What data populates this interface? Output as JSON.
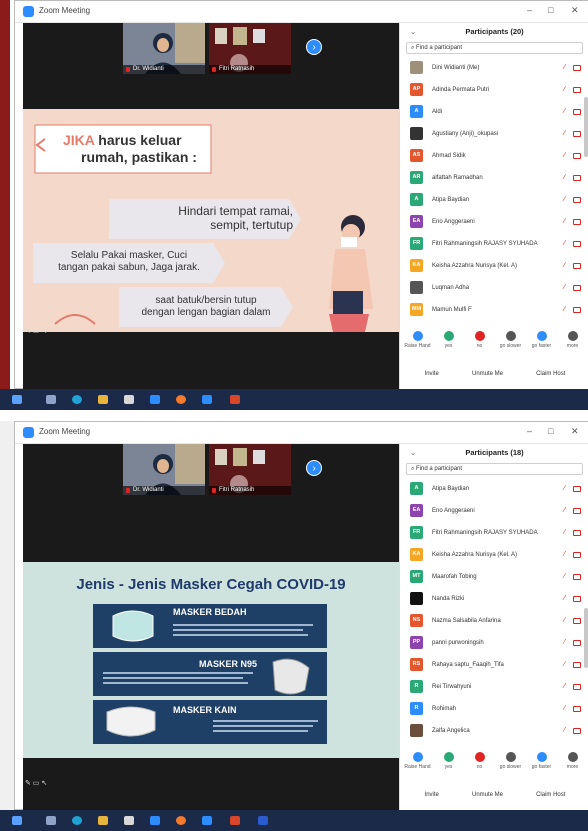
{
  "window": {
    "title": "Zoom Meeting",
    "min": "–",
    "max": "□",
    "close": "✕"
  },
  "video": {
    "person1": "Dr. Widianti",
    "person2": "Fitri Ratnasih"
  },
  "s1": {
    "participants_title": "Participants (20)",
    "search_placeholder": "Find a participant",
    "slide": {
      "jika": "JIKA",
      "heading_rest": "harus keluar",
      "heading_line2": "rumah, pastikan :",
      "b1_l1": "Hindari tempat ramai,",
      "b1_l2": "sempit, tertutup",
      "b2_l1": "Selalu Pakai masker, Cuci",
      "b2_l2": "tangan pakai sabun, Jaga jarak.",
      "b3_l1": "saat batuk/bersin tutup",
      "b3_l2": "dengan lengan  bagian dalam"
    },
    "participants": [
      {
        "initials": "",
        "name": "Dini Widianti (Me)",
        "color": "#9e8f7a"
      },
      {
        "initials": "AP",
        "name": "Adinda Permata Putri",
        "color": "#e4572e"
      },
      {
        "initials": "A",
        "name": "Aldi",
        "color": "#2d8cff"
      },
      {
        "initials": "",
        "name": "Agustiany (Anji)_okupasi",
        "color": "#333333"
      },
      {
        "initials": "AS",
        "name": "Ahmad Sidik",
        "color": "#e4572e"
      },
      {
        "initials": "AR",
        "name": "alfattah Ramadhan",
        "color": "#2aa876"
      },
      {
        "initials": "A",
        "name": "Atipa Baydian",
        "color": "#2aa876"
      },
      {
        "initials": "EA",
        "name": "Eno Anggeraeni",
        "color": "#8e44ad"
      },
      {
        "initials": "FR",
        "name": "Fitri Rahmaningsih RAJASY SYUHADA",
        "color": "#2aa876"
      },
      {
        "initials": "KA",
        "name": "Keisha Azzahra Nurisya (Kel. A)",
        "color": "#f5a623"
      },
      {
        "initials": "",
        "name": "Luqman Adha",
        "color": "#555555"
      },
      {
        "initials": "MM",
        "name": "Mamun Mulfi F",
        "color": "#f5a623"
      }
    ]
  },
  "s2": {
    "participants_title": "Participants (18)",
    "search_placeholder": "Find a participant",
    "slide": {
      "title": "Jenis - Jenis Masker Cegah COVID-19",
      "m1": "MASKER BEDAH",
      "m2": "MASKER N95",
      "m3": "MASKER KAIN"
    },
    "participants": [
      {
        "initials": "A",
        "name": "Atipa Baydian",
        "color": "#2aa876"
      },
      {
        "initials": "EA",
        "name": "Eno Anggeraeni",
        "color": "#8e44ad"
      },
      {
        "initials": "FR",
        "name": "Fitri Rahmaningsih RAJASY SYUHADA",
        "color": "#2aa876"
      },
      {
        "initials": "KA",
        "name": "Keisha Azzahra Nurisya (Kel. A)",
        "color": "#f5a623"
      },
      {
        "initials": "MT",
        "name": "Maarofah Tobing",
        "color": "#2aa876"
      },
      {
        "initials": "",
        "name": "Nanda Rizki",
        "color": "#111111"
      },
      {
        "initials": "NS",
        "name": "Nazma Salsabila Anfarina",
        "color": "#e4572e"
      },
      {
        "initials": "PP",
        "name": "panni purwoningsih",
        "color": "#8e44ad"
      },
      {
        "initials": "RS",
        "name": "Rahaya saptu_Faaqih_Tifa",
        "color": "#e4572e"
      },
      {
        "initials": "R",
        "name": "Rei Tirwahyuni",
        "color": "#2aa876"
      },
      {
        "initials": "R",
        "name": "Rohimah",
        "color": "#2d8cff"
      },
      {
        "initials": "",
        "name": "Zalfa Angelica",
        "color": "#6b4f3a"
      }
    ]
  },
  "reactions": [
    {
      "label": "Raise Hand",
      "color": "#2d8cff"
    },
    {
      "label": "yes",
      "color": "#2aa876"
    },
    {
      "label": "no",
      "color": "#e02424"
    },
    {
      "label": "go slower",
      "color": "#555555"
    },
    {
      "label": "go faster",
      "color": "#2d8cff"
    },
    {
      "label": "more",
      "color": "#555555"
    }
  ],
  "buttons": {
    "invite": "Invite",
    "unmute": "Unmute Me",
    "claim": "Claim Host"
  }
}
